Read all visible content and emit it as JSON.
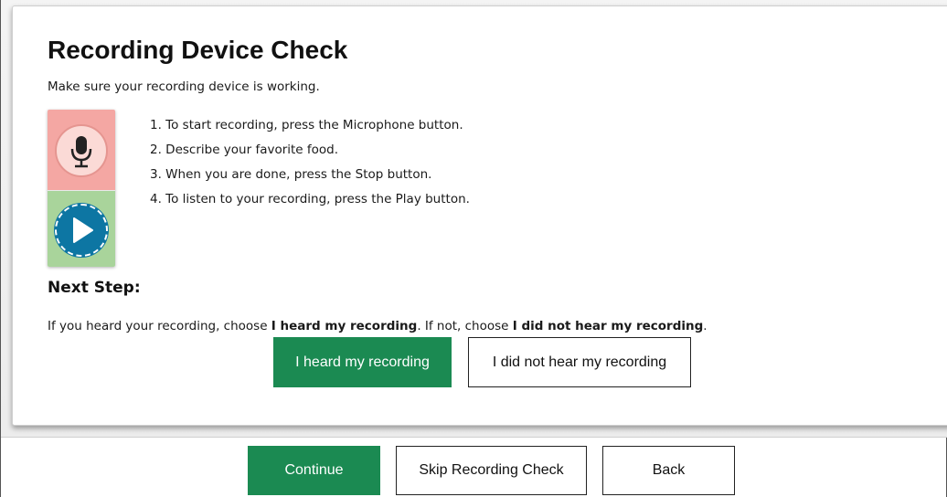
{
  "dialog": {
    "title": "Recording Device Check",
    "subtitle": "Make sure your recording device is working.",
    "device_icons": {
      "record": "microphone-icon",
      "play": "play-icon",
      "record_bg": "#f4a7a3",
      "play_bg": "#a9d49b",
      "play_button_color": "#0d76a3"
    },
    "steps": [
      "1. To start recording, press the Microphone button.",
      "2. Describe your favorite food.",
      "3. When you are done, press the Stop button.",
      "4. To listen to your recording, press the Play button."
    ],
    "next_step_heading": "Next Step:",
    "instruction": {
      "part1": "If you heard your recording, choose ",
      "bold1": "I heard my recording",
      "part2": ". If not, choose ",
      "bold2": "I did not hear my recording",
      "part3": "."
    },
    "heard_button": "I heard my recording",
    "not_heard_button": "I did not hear my recording"
  },
  "footer": {
    "continue_label": "Continue",
    "skip_label": "Skip Recording Check",
    "back_label": "Back"
  },
  "colors": {
    "accent_green": "#1b8a52"
  }
}
